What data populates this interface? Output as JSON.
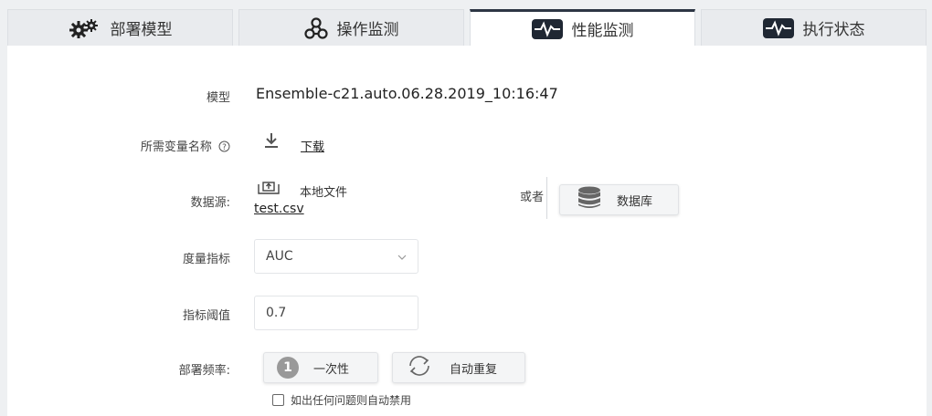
{
  "tabs": [
    {
      "label": "部署模型",
      "icon": "gears-icon"
    },
    {
      "label": "操作监测",
      "icon": "network-icon"
    },
    {
      "label": "性能监测",
      "icon": "pulse-icon"
    },
    {
      "label": "执行状态",
      "icon": "pulse-icon"
    }
  ],
  "active_tab": 2,
  "form": {
    "model_label": "模型",
    "model_value": "Ensemble-c21.auto.06.28.2019_10:16:47",
    "vars_label": "所需变量名称",
    "download_label": "下载",
    "datasource_label": "数据源:",
    "local_file_label": "本地文件",
    "file_name": "test.csv",
    "or_label": "或者",
    "database_label": "数据库",
    "metric_label": "度量指标",
    "metric_value": "AUC",
    "threshold_label": "指标阈值",
    "threshold_value": "0.7",
    "frequency_label": "部署频率:",
    "once_label": "一次性",
    "once_number": "1",
    "auto_repeat_label": "自动重复",
    "auto_disable_label": "如出任何问题则自动禁用",
    "auto_disable_checked": false
  },
  "colors": {
    "active_tab_border": "#2d3644",
    "tab_bg": "#e9ebee",
    "panel_bg": "#ffffff"
  }
}
